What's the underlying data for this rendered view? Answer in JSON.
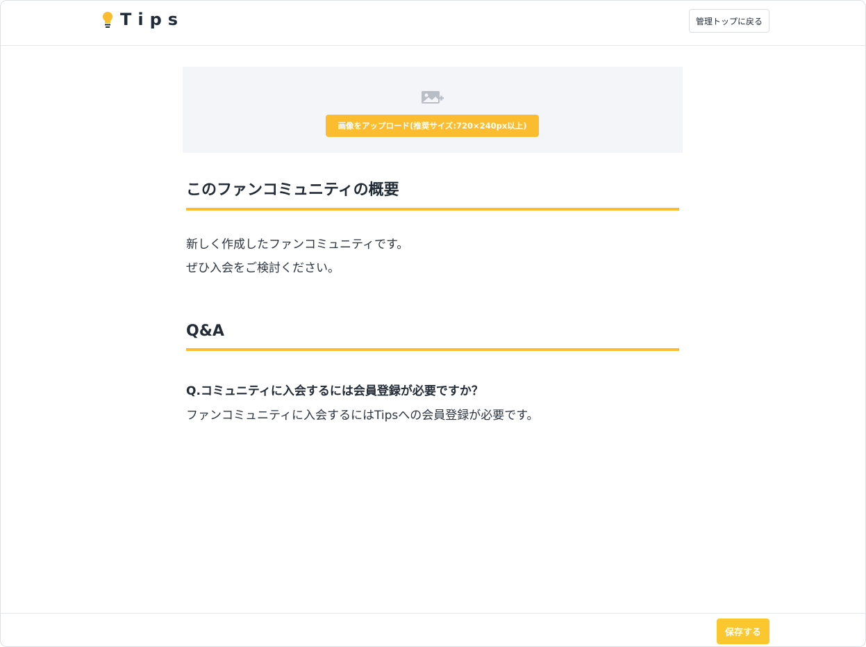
{
  "header": {
    "logo_text": "Tips",
    "logo_icon": "lightbulb-icon",
    "back_label": "管理トップに戻る"
  },
  "upload": {
    "icon": "add-image-icon",
    "button_label": "画像をアップロード(推奨サイズ:720×240px以上)"
  },
  "overview": {
    "title": "このファンコミュニティの概要",
    "lines": [
      "新しく作成したファンコミュニティです。",
      "ぜひ入会をご検討ください。"
    ]
  },
  "qa": {
    "title": "Q&A",
    "question": "Q.コミュニティに入会するには会員登録が必要ですか？",
    "answer": "ファンコミュニティに入会するにはTipsへの会員登録が必要です。"
  },
  "footer": {
    "save_label": "保存する"
  },
  "colors": {
    "accent": "#fbbd2f",
    "text": "#222b36",
    "upload_bg": "#f4f5f8"
  }
}
